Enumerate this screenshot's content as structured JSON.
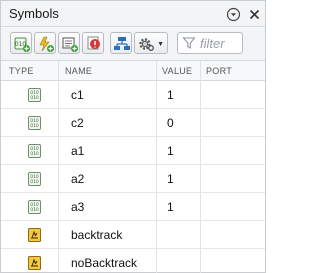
{
  "panel": {
    "title": "Symbols"
  },
  "toolbar": {
    "filter_placeholder": "filter",
    "buttons": [
      "add-data-button",
      "add-event-button",
      "add-message-button",
      "resolve-undefined-button",
      "hierarchy-button",
      "settings-button"
    ]
  },
  "table": {
    "headers": {
      "type": "TYPE",
      "name": "NAME",
      "value": "VALUE",
      "port": "PORT"
    },
    "rows": [
      {
        "type": "data",
        "name": "c1",
        "value": "1",
        "port": ""
      },
      {
        "type": "data",
        "name": "c2",
        "value": "0",
        "port": ""
      },
      {
        "type": "data",
        "name": "a1",
        "value": "1",
        "port": ""
      },
      {
        "type": "data",
        "name": "a2",
        "value": "1",
        "port": ""
      },
      {
        "type": "data",
        "name": "a3",
        "value": "1",
        "port": ""
      },
      {
        "type": "event",
        "name": "backtrack",
        "value": "",
        "port": ""
      },
      {
        "type": "event",
        "name": "noBacktrack",
        "value": "",
        "port": ""
      }
    ]
  },
  "colors": {
    "accent_green": "#3aa13a",
    "accent_blue": "#2a6fbf",
    "warning_red": "#d23a3a",
    "event_yellow": "#e8b923"
  }
}
